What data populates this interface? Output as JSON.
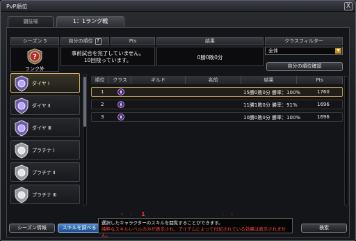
{
  "window": {
    "title": "PvP順位",
    "close_glyph": "X"
  },
  "tabs": [
    {
      "label": "闘技場",
      "active": false
    },
    {
      "label": "1：1ランク戦",
      "active": true
    }
  ],
  "header": {
    "season": "シーズン 5",
    "my_rank_label": "自分の順位",
    "help_glyph": "?",
    "pts_label": "Pts",
    "result_label": "結果",
    "class_filter_label": "クラスフィルター"
  },
  "my_info": {
    "rank_badge_label": "ランク外",
    "message_line1": "事前試合を完了していません。",
    "message_line2": "10回残っています。",
    "pts_value": "",
    "result_value": "0勝0敗0分"
  },
  "class_filter": {
    "selected": "全体"
  },
  "my_rank_button": "自分の順位確認",
  "tiers": [
    {
      "label": "ダイヤ I",
      "selected": true,
      "kind": "diamond"
    },
    {
      "label": "ダイヤ Ⅱ",
      "selected": false,
      "kind": "diamond"
    },
    {
      "label": "ダイヤ Ⅲ",
      "selected": false,
      "kind": "diamond"
    },
    {
      "label": "プラチナ I",
      "selected": false,
      "kind": "platinum"
    },
    {
      "label": "プラチナ Ⅱ",
      "selected": false,
      "kind": "platinum"
    },
    {
      "label": "プラチナ Ⅲ",
      "selected": false,
      "kind": "platinum"
    }
  ],
  "table": {
    "columns": [
      "順位",
      "クラス",
      "ギルド",
      "名前",
      "結果",
      "Pts"
    ],
    "rows": [
      {
        "rank": "1",
        "class_icon": "class-emblem-icon",
        "guild": "",
        "name": "",
        "result": "15勝0敗0分 勝率：100%",
        "pts": "1760",
        "selected": true
      },
      {
        "rank": "2",
        "class_icon": "class-emblem-icon",
        "guild": "",
        "name": "",
        "result": "11勝1敗0分 勝率：91%",
        "pts": "1696",
        "selected": false
      },
      {
        "rank": "3",
        "class_icon": "class-emblem-icon",
        "guild": "",
        "name": "",
        "result": "10勝0敗0分 勝率：100%",
        "pts": "1696",
        "selected": false
      }
    ]
  },
  "pager": {
    "current": "1"
  },
  "buttons": {
    "season_info": "シーズン情報",
    "view_skills": "スキルを調べる",
    "search": "検索"
  },
  "tooltip": {
    "line1": "選択したキャラクターのスキルを閲覧することができます。",
    "line2": "純粋なスキルレベルのみが表示され、アイテムによって付加されている効果は表示されません。"
  }
}
